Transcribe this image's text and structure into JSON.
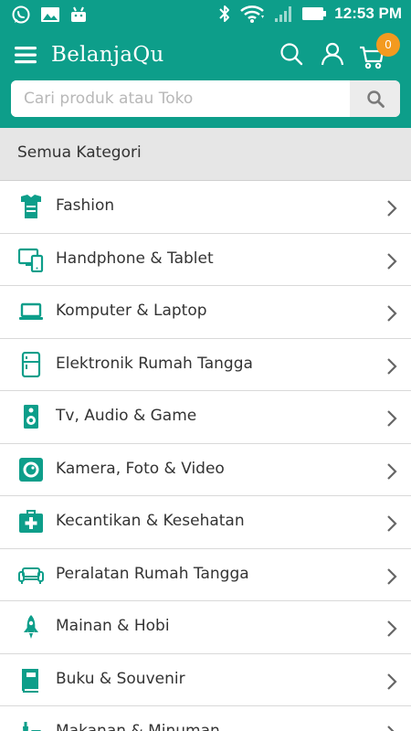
{
  "status_bar": {
    "time": "12:53 PM",
    "icons": [
      "whatsapp-icon",
      "image-icon",
      "android-icon",
      "bluetooth-icon",
      "wifi-icon",
      "signal-icon",
      "battery-icon"
    ]
  },
  "app_bar": {
    "brand": "BelanjaQu",
    "cart_count": "0",
    "search_placeholder": "Cari produk atau Toko",
    "search_value": "",
    "colors": {
      "primary": "#0d9e8a",
      "badge": "#f39a1f"
    }
  },
  "section": {
    "title": "Semua Kategori"
  },
  "categories": [
    {
      "label": "Fashion",
      "icon": "shirt-icon"
    },
    {
      "label": "Handphone & Tablet",
      "icon": "devices-icon"
    },
    {
      "label": "Komputer & Laptop",
      "icon": "laptop-icon"
    },
    {
      "label": "Elektronik Rumah Tangga",
      "icon": "fridge-icon"
    },
    {
      "label": "Tv, Audio & Game",
      "icon": "speaker-icon"
    },
    {
      "label": "Kamera, Foto & Video",
      "icon": "camera-icon"
    },
    {
      "label": "Kecantikan & Kesehatan",
      "icon": "medkit-icon"
    },
    {
      "label": "Peralatan Rumah Tangga",
      "icon": "sofa-icon"
    },
    {
      "label": "Mainan & Hobi",
      "icon": "rocket-icon"
    },
    {
      "label": "Buku & Souvenir",
      "icon": "book-icon"
    },
    {
      "label": "Makanan & Minuman",
      "icon": "food-icon"
    }
  ]
}
